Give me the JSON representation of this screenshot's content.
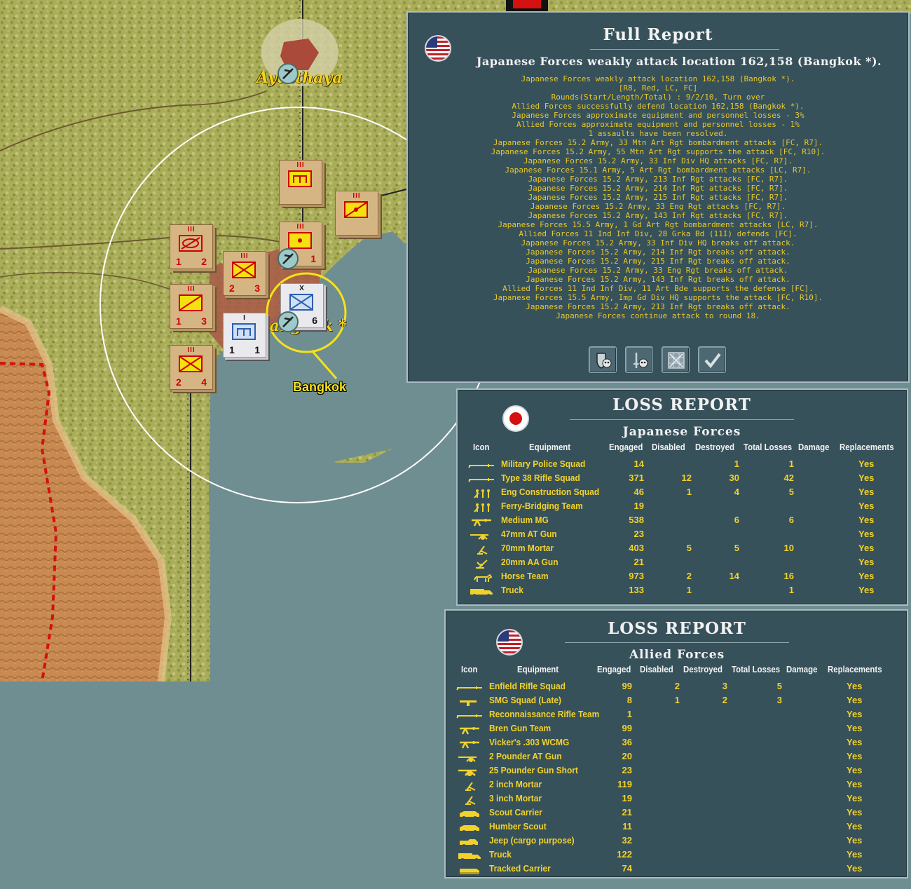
{
  "map": {
    "city_top_label": "Ayutthaya",
    "city_main_label": "Bangkok *",
    "place_label": "Bangkok",
    "counters": [
      {
        "name": "counter-jp-art-1",
        "side": "jp",
        "size": "III",
        "v1": "",
        "v2": ""
      },
      {
        "name": "counter-jp-art-2",
        "side": "jp",
        "size": "III",
        "v1": "",
        "v2": ""
      },
      {
        "name": "counter-jp-hq",
        "side": "jp",
        "size": "III",
        "v1": "",
        "v2": "1"
      },
      {
        "name": "counter-jp-armor",
        "side": "jp",
        "size": "III",
        "v1": "1",
        "v2": "2"
      },
      {
        "name": "counter-jp-inf-23",
        "side": "jp",
        "size": "III",
        "v1": "2",
        "v2": "3"
      },
      {
        "name": "counter-jp-inf-13",
        "side": "jp",
        "size": "III",
        "v1": "1",
        "v2": "3"
      },
      {
        "name": "counter-jp-inf-24",
        "side": "jp",
        "size": "III",
        "v1": "2",
        "v2": "4"
      },
      {
        "name": "counter-al-brigade",
        "side": "al",
        "size": "X",
        "v1": "",
        "v2": "6"
      },
      {
        "name": "counter-al-art",
        "side": "al",
        "size": "I",
        "v1": "1",
        "v2": "1"
      }
    ]
  },
  "full_report": {
    "title": "Full Report",
    "headline": "Japanese Forces weakly attack location 162,158 (Bangkok *).",
    "lines": [
      "Japanese Forces weakly attack location 162,158 (Bangkok *).",
      "[R8, Red, LC, FC]",
      "Rounds(Start/Length/Total) : 9/2/10, Turn over",
      "Allied Forces successfully defend location 162,158 (Bangkok *).",
      "Japanese Forces approximate equipment and personnel losses - 3%",
      "Allied Forces approximate equipment and personnel losses - 1%",
      "1 assaults have been resolved.",
      "Japanese Forces 15.2 Army, 33 Mtn Art Rgt bombardment attacks [FC, R7].",
      "Japanese Forces 15.2 Army, 55 Mtn Art Rgt supports the attack [FC, R10].",
      "Japanese Forces 15.2 Army, 33 Inf Div HQ attacks [FC, R7].",
      "Japanese Forces 15.1 Army, 5 Art Rgt bombardment attacks [LC, R7].",
      "Japanese Forces 15.2 Army, 213 Inf Rgt attacks [FC, R7].",
      "Japanese Forces 15.2 Army, 214 Inf Rgt attacks [FC, R7].",
      "Japanese Forces 15.2 Army, 215 Inf Rgt attacks [FC, R7].",
      "Japanese Forces 15.2 Army, 33 Eng Rgt attacks [FC, R7].",
      "Japanese Forces 15.2 Army, 143 Inf Rgt attacks [FC, R7].",
      "Japanese Forces 15.5 Army, 1 Gd Art Rgt bombardment attacks [LC, R7].",
      "Allied Forces 11 Ind Inf Div, 28 Grka Bd (11I) defends [FC].",
      "Japanese Forces 15.2 Army, 33 Inf Div HQ breaks off attack.",
      "Japanese Forces 15.2 Army, 214 Inf Rgt breaks off attack.",
      "Japanese Forces 15.2 Army, 215 Inf Rgt breaks off attack.",
      "Japanese Forces 15.2 Army, 33 Eng Rgt breaks off attack.",
      "Japanese Forces 15.2 Army, 143 Inf Rgt breaks off attack.",
      "Allied Forces 11 Ind Inf Div, 11 Art Bde supports the defense [FC].",
      "Japanese Forces 15.5 Army, Imp Gd Div HQ supports the attack [FC, R10].",
      "Japanese Forces 15.2 Army, 213 Inf Rgt breaks off attack.",
      "Japanese Forces continue attack to round 18."
    ],
    "buttons": [
      {
        "name": "defender-losses-button",
        "icon": "shield-skull-icon"
      },
      {
        "name": "attacker-losses-button",
        "icon": "sword-skull-icon"
      },
      {
        "name": "map-grid-button",
        "icon": "grid-map-icon"
      },
      {
        "name": "confirm-button",
        "icon": "checkmark-icon"
      }
    ]
  },
  "jp_loss": {
    "title": "LOSS REPORT",
    "side": "Japanese Forces",
    "headers": [
      "Icon",
      "Equipment",
      "Engaged",
      "Disabled",
      "Destroyed",
      "Total Losses",
      "Damage",
      "Replacements"
    ],
    "rows": [
      {
        "icon": "rifle-icon",
        "equipment": "Military Police Squad",
        "engaged": "14",
        "disabled": "",
        "destroyed": "1",
        "total": "1",
        "damage": "",
        "replacements": "Yes"
      },
      {
        "icon": "rifle-icon",
        "equipment": "Type 38 Rifle Squad",
        "engaged": "371",
        "disabled": "12",
        "destroyed": "30",
        "total": "42",
        "damage": "",
        "replacements": "Yes"
      },
      {
        "icon": "engineers-icon",
        "equipment": "Eng Construction Squad",
        "engaged": "46",
        "disabled": "1",
        "destroyed": "4",
        "total": "5",
        "damage": "",
        "replacements": "Yes"
      },
      {
        "icon": "engineers-icon",
        "equipment": "Ferry-Bridging Team",
        "engaged": "19",
        "disabled": "",
        "destroyed": "",
        "total": "",
        "damage": "",
        "replacements": "Yes"
      },
      {
        "icon": "machine-gun-icon",
        "equipment": "Medium MG",
        "engaged": "538",
        "disabled": "",
        "destroyed": "6",
        "total": "6",
        "damage": "",
        "replacements": "Yes"
      },
      {
        "icon": "at-gun-icon",
        "equipment": "47mm AT Gun",
        "engaged": "23",
        "disabled": "",
        "destroyed": "",
        "total": "",
        "damage": "",
        "replacements": "Yes"
      },
      {
        "icon": "mortar-icon",
        "equipment": "70mm Mortar",
        "engaged": "403",
        "disabled": "5",
        "destroyed": "5",
        "total": "10",
        "damage": "",
        "replacements": "Yes"
      },
      {
        "icon": "aa-gun-icon",
        "equipment": "20mm AA Gun",
        "engaged": "21",
        "disabled": "",
        "destroyed": "",
        "total": "",
        "damage": "",
        "replacements": "Yes"
      },
      {
        "icon": "horse-icon",
        "equipment": "Horse Team",
        "engaged": "973",
        "disabled": "2",
        "destroyed": "14",
        "total": "16",
        "damage": "",
        "replacements": "Yes"
      },
      {
        "icon": "truck-icon",
        "equipment": "Truck",
        "engaged": "133",
        "disabled": "1",
        "destroyed": "",
        "total": "1",
        "damage": "",
        "replacements": "Yes"
      }
    ]
  },
  "al_loss": {
    "title": "LOSS REPORT",
    "side": "Allied Forces",
    "headers": [
      "Icon",
      "Equipment",
      "Engaged",
      "Disabled",
      "Destroyed",
      "Total Losses",
      "Damage",
      "Replacements"
    ],
    "rows": [
      {
        "icon": "rifle-icon",
        "equipment": "Enfield Rifle Squad",
        "engaged": "99",
        "disabled": "2",
        "destroyed": "3",
        "total": "5",
        "damage": "",
        "replacements": "Yes"
      },
      {
        "icon": "smg-icon",
        "equipment": "SMG Squad (Late)",
        "engaged": "8",
        "disabled": "1",
        "destroyed": "2",
        "total": "3",
        "damage": "",
        "replacements": "Yes"
      },
      {
        "icon": "rifle-icon",
        "equipment": "Reconnaissance Rifle Team",
        "engaged": "1",
        "disabled": "",
        "destroyed": "",
        "total": "",
        "damage": "",
        "replacements": "Yes"
      },
      {
        "icon": "machine-gun-icon",
        "equipment": "Bren Gun Team",
        "engaged": "99",
        "disabled": "",
        "destroyed": "",
        "total": "",
        "damage": "",
        "replacements": "Yes"
      },
      {
        "icon": "machine-gun-icon",
        "equipment": "Vicker's .303 WCMG",
        "engaged": "36",
        "disabled": "",
        "destroyed": "",
        "total": "",
        "damage": "",
        "replacements": "Yes"
      },
      {
        "icon": "at-gun-icon",
        "equipment": "2 Pounder AT Gun",
        "engaged": "20",
        "disabled": "",
        "destroyed": "",
        "total": "",
        "damage": "",
        "replacements": "Yes"
      },
      {
        "icon": "field-gun-icon",
        "equipment": "25 Pounder Gun Short",
        "engaged": "23",
        "disabled": "",
        "destroyed": "",
        "total": "",
        "damage": "",
        "replacements": "Yes"
      },
      {
        "icon": "mortar-icon",
        "equipment": "2 inch Mortar",
        "engaged": "119",
        "disabled": "",
        "destroyed": "",
        "total": "",
        "damage": "",
        "replacements": "Yes"
      },
      {
        "icon": "mortar-icon",
        "equipment": "3 inch Mortar",
        "engaged": "19",
        "disabled": "",
        "destroyed": "",
        "total": "",
        "damage": "",
        "replacements": "Yes"
      },
      {
        "icon": "armored-car-icon",
        "equipment": "Scout Carrier",
        "engaged": "21",
        "disabled": "",
        "destroyed": "",
        "total": "",
        "damage": "",
        "replacements": "Yes"
      },
      {
        "icon": "armored-car-icon",
        "equipment": "Humber Scout",
        "engaged": "11",
        "disabled": "",
        "destroyed": "",
        "total": "",
        "damage": "",
        "replacements": "Yes"
      },
      {
        "icon": "jeep-icon",
        "equipment": "Jeep (cargo purpose)",
        "engaged": "32",
        "disabled": "",
        "destroyed": "",
        "total": "",
        "damage": "",
        "replacements": "Yes"
      },
      {
        "icon": "truck-icon",
        "equipment": "Truck",
        "engaged": "122",
        "disabled": "",
        "destroyed": "",
        "total": "",
        "damage": "",
        "replacements": "Yes"
      },
      {
        "icon": "tracked-carrier-icon",
        "equipment": "Tracked Carrier",
        "engaged": "74",
        "disabled": "",
        "destroyed": "",
        "total": "",
        "damage": "",
        "replacements": "Yes"
      }
    ]
  },
  "colors": {
    "jungle": "#a9ad5a",
    "sea": "#6f8e91",
    "desert": "#c98a52",
    "panel": "#37515b",
    "report_text": "#e8c82a",
    "table_text": "#f2d22a",
    "border_line": "#d41010"
  }
}
